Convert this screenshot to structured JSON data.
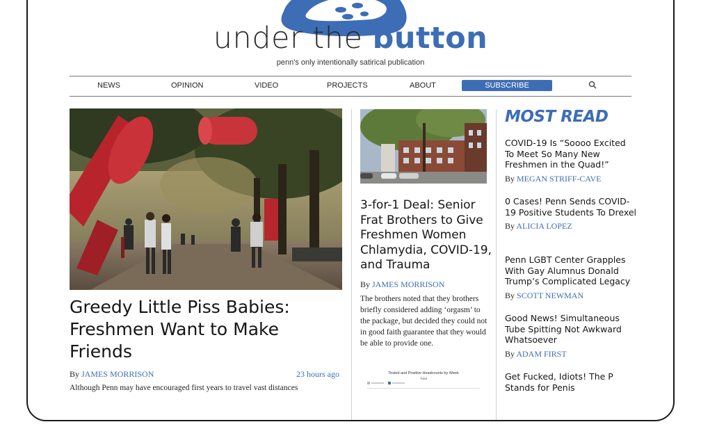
{
  "site": {
    "title_part1": "under the ",
    "title_part2": "button",
    "tagline": "penn's only intentionally satirical publication"
  },
  "nav": {
    "items": [
      "NEWS",
      "OPINION",
      "VIDEO",
      "PROJECTS",
      "ABOUT"
    ],
    "subscribe": "SUBSCRIBE",
    "search_icon": "search-icon"
  },
  "colors": {
    "accent": "#3d6db5"
  },
  "feature": {
    "title": "Greedy Little Piss Babies: Freshmen Want to Make Friends",
    "by": "By ",
    "author": "JAMES MORRISON",
    "time": "23 hours ago",
    "excerpt": "Although Penn may have encouraged first years to travel vast distances"
  },
  "middle": {
    "title": "3-for-1 Deal: Senior Frat Brothers to Give Freshmen Women Chlamydia, COVID-19, and Trauma",
    "by": "By ",
    "author": "JAMES MORRISON",
    "excerpt": "The brothers noted that they brothers briefly considered adding ‘orgasm’ to the package, but decided they could not in good faith guarantee that they would be able to provide one.",
    "chart_title": "Tested and Positive Headcounts by Week",
    "chart_subtitle": "Total"
  },
  "most_read": {
    "heading": "MOST READ",
    "items": [
      {
        "title": "COVID-19 Is “Soooo Excited To Meet So Many New Freshmen in the Quad!”",
        "by": "By ",
        "author": "MEGAN STRIFF-CAVE"
      },
      {
        "title": "0 Cases! Penn Sends COVID-19 Positive Students To Drexel",
        "by": "By ",
        "author": "ALICIA LOPEZ"
      },
      {
        "title": "Penn LGBT Center Grapples With Gay Alumnus Donald Trump’s Complicated Legacy",
        "by": "By ",
        "author": "SCOTT NEWMAN"
      },
      {
        "title": "Good News! Simultaneous Tube Spitting Not Awkward Whatsoever",
        "by": "By ",
        "author": "ADAM FIRST"
      },
      {
        "title": "Get Fucked, Idiots! The P Stands for Penis",
        "by": "",
        "author": ""
      }
    ]
  }
}
